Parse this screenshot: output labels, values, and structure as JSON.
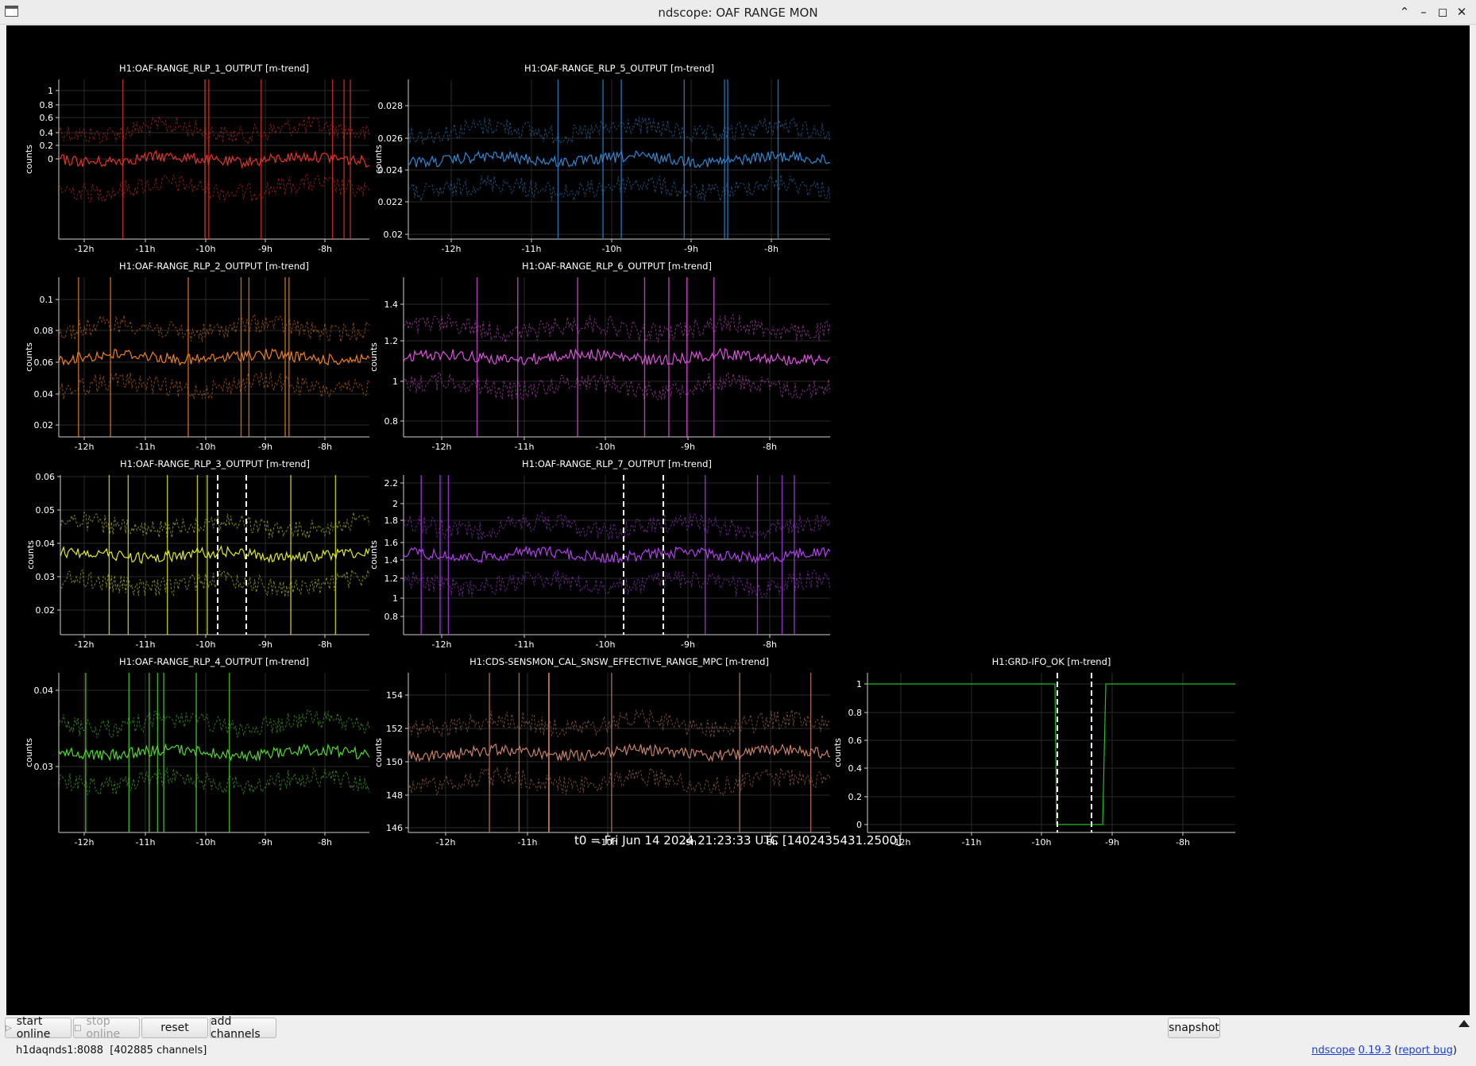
{
  "window": {
    "title": "ndscope: OAF RANGE MON"
  },
  "t0_label": "t0 = Fri Jun 14 2024 21:23:33 UTC [1402435431.2500]",
  "x_ticks": [
    "-12h",
    "-11h",
    "-10h",
    "-9h",
    "-8h"
  ],
  "plots": [
    {
      "id": "rlp1",
      "title": "H1:OAF-RANGE_RLP_1_OUTPUT [m-trend]",
      "ylabel": "counts",
      "color": "#e8302a",
      "yticks": [
        "1",
        "0.8",
        "0.6",
        "0.4",
        "0.2",
        "0"
      ],
      "markers": false
    },
    {
      "id": "rlp5",
      "title": "H1:OAF-RANGE_RLP_5_OUTPUT [m-trend]",
      "ylabel": "counts",
      "color": "#2e86d4",
      "yticks": [
        "0.028",
        "0.026",
        "0.024",
        "0.022",
        "0.02"
      ],
      "markers": false
    },
    {
      "id": "rlp2",
      "title": "H1:OAF-RANGE_RLP_2_OUTPUT [m-trend]",
      "ylabel": "counts",
      "color": "#f07f1a",
      "yticks": [
        "0.1",
        "0.08",
        "0.06",
        "0.04",
        "0.02"
      ],
      "markers": false
    },
    {
      "id": "rlp6",
      "title": "H1:OAF-RANGE_RLP_6_OUTPUT [m-trend]",
      "ylabel": "counts",
      "color": "#e050e0",
      "yticks": [
        "1.4",
        "1.2",
        "1",
        "0.8"
      ],
      "markers": false
    },
    {
      "id": "rlp3",
      "title": "H1:OAF-RANGE_RLP_3_OUTPUT [m-trend]",
      "ylabel": "counts",
      "color": "#e2ea2a",
      "yticks": [
        "0.06",
        "0.05",
        "0.04",
        "0.03",
        "0.02"
      ],
      "markers": true
    },
    {
      "id": "rlp7",
      "title": "H1:OAF-RANGE_RLP_7_OUTPUT [m-trend]",
      "ylabel": "counts",
      "color": "#b040f0",
      "yticks": [
        "2.2",
        "2",
        "1.8",
        "1.6",
        "1.4",
        "1.2",
        "1",
        "0.8"
      ],
      "markers": true
    },
    {
      "id": "rlp4",
      "title": "H1:OAF-RANGE_RLP_4_OUTPUT [m-trend]",
      "ylabel": "counts",
      "color": "#4ed82a",
      "yticks": [
        "0.04",
        "0.03"
      ],
      "markers": false
    },
    {
      "id": "sensmon",
      "title": "H1:CDS-SENSMON_CAL_SNSW_EFFECTIVE_RANGE_MPC [m-trend]",
      "ylabel": "counts",
      "color": "#c88064",
      "yticks": [
        "154",
        "152",
        "150",
        "148",
        "146"
      ],
      "markers": false
    },
    {
      "id": "ifo_ok",
      "title": "H1:GRD-IFO_OK [m-trend]",
      "ylabel": "counts",
      "color": "#22c022",
      "yticks": [
        "1",
        "0.8",
        "0.6",
        "0.4",
        "0.2",
        "0"
      ],
      "markers": true
    }
  ],
  "toolbar": {
    "start_online": "start online",
    "stop_online": "stop online",
    "reset": "reset",
    "add_channels": "add channels",
    "snapshot": "snapshot"
  },
  "status": {
    "server": "h1daqnds1:8088  [402885 channels]",
    "app_name": "ndscope",
    "version": "0.19.3",
    "report_bug": "report bug"
  }
}
